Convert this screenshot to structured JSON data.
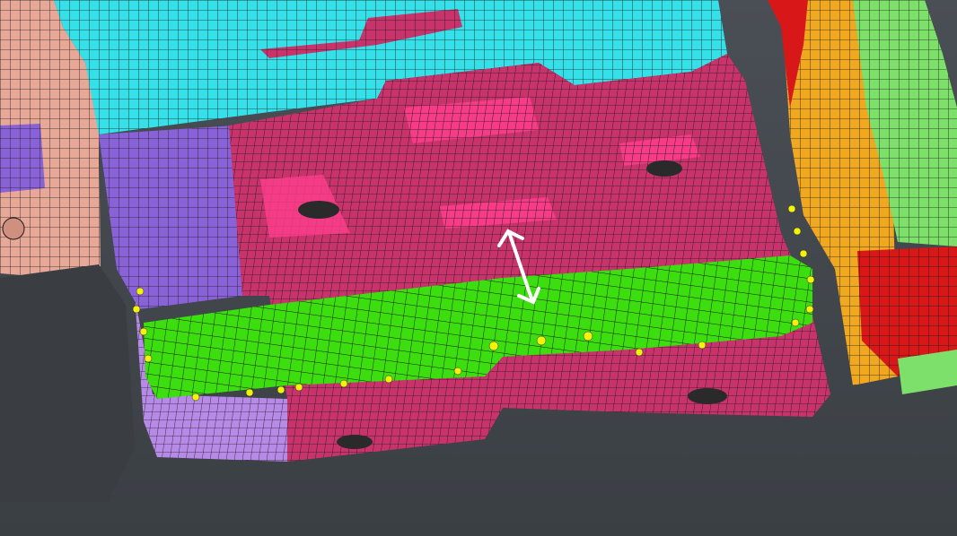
{
  "viewport": {
    "background_color": "#3e4348",
    "background_gradient_top": "#4a4f55",
    "mesh_line_color": "#1a1a1a"
  },
  "parts": [
    {
      "name": "cyan-panel",
      "color": "#36e0e8"
    },
    {
      "name": "pink-floor-panel",
      "color": "#c8336c"
    },
    {
      "name": "pink-floor-panel-highlight",
      "color": "#ff3d8c"
    },
    {
      "name": "purple-panel",
      "color": "#8a62d8"
    },
    {
      "name": "lavender-panel",
      "color": "#b88ae8"
    },
    {
      "name": "salmon-bracket",
      "color": "#e8a898"
    },
    {
      "name": "green-crossmember",
      "color": "#3dde0f"
    },
    {
      "name": "orange-rail",
      "color": "#f0a820"
    },
    {
      "name": "light-green-rail",
      "color": "#7de06a"
    },
    {
      "name": "red-rail",
      "color": "#d81818"
    }
  ],
  "weld_points": {
    "color": "#f2f20a",
    "count": 22
  },
  "annotation": {
    "icon": "double-arrow-icon",
    "color": "#ffffff"
  }
}
